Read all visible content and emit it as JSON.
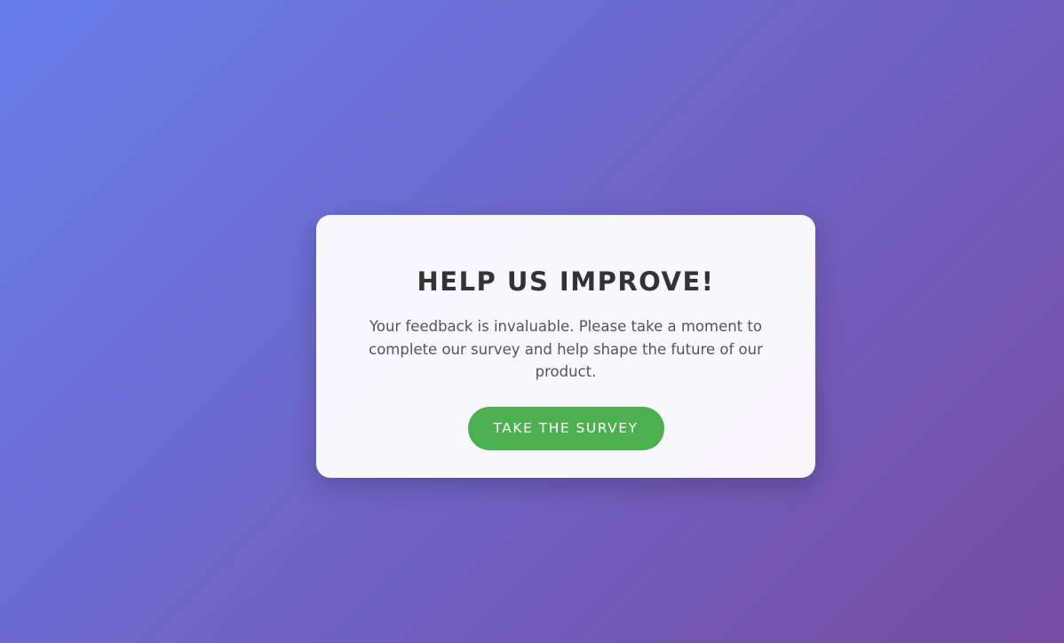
{
  "survey_card": {
    "title": "HELP US IMPROVE!",
    "message": "Your feedback is invaluable. Please take a moment to complete our survey and help shape the future of our product.",
    "button_label": "TAKE THE SURVEY"
  },
  "colors": {
    "background_start": "#667eea",
    "background_end": "#764ba2",
    "button": "#4caf50",
    "title_text": "#333333",
    "body_text": "#555555"
  }
}
